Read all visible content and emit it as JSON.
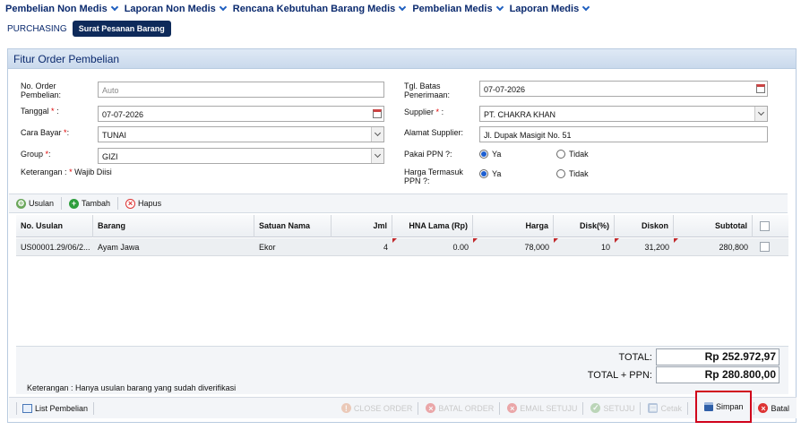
{
  "menu": {
    "items": [
      "Pembelian Non Medis",
      "Laporan Non Medis",
      "Rencana Kebutuhan Barang Medis",
      "Pembelian Medis",
      "Laporan Medis"
    ]
  },
  "subnav": {
    "link": "PURCHASING",
    "active": "Surat Pesanan Barang"
  },
  "panel": {
    "title": "Fitur Order Pembelian"
  },
  "form": {
    "no_order_label": "No. Order Pembelian:",
    "no_order_placeholder": "Auto",
    "tanggal_label": "Tanggal",
    "tanggal_value": "07-07-2026",
    "cara_bayar_label": "Cara Bayar",
    "cara_bayar_value": "TUNAI",
    "group_label": "Group",
    "group_value": "GIZI",
    "keterangan_prefix": "Keterangan :",
    "keterangan_suffix": "Wajib Diisi",
    "req_mark": "*",
    "colon": ":",
    "tgl_batas_label": "Tgl. Batas Penerimaan:",
    "tgl_batas_value": "07-07-2026",
    "supplier_label": "Supplier",
    "supplier_value": "PT. CHAKRA KHAN",
    "alamat_label": "Alamat Supplier:",
    "alamat_value": "Jl. Dupak Masigit No. 51",
    "pakai_ppn_label": "Pakai PPN ?:",
    "harga_ppn_label": "Harga Termasuk PPN ?:",
    "ya": "Ya",
    "tidak": "Tidak"
  },
  "grid_toolbar": {
    "usulan": "Usulan",
    "tambah": "Tambah",
    "hapus": "Hapus"
  },
  "columns": [
    "No. Usulan",
    "Barang",
    "Satuan Nama",
    "Jml",
    "HNA Lama (Rp)",
    "Harga",
    "Disk(%)",
    "Diskon",
    "Subtotal"
  ],
  "rows": [
    {
      "no_usulan": "US00001.29/06/2...",
      "barang": "Ayam Jawa",
      "satuan": "Ekor",
      "jml": "4",
      "hna": "0.00",
      "harga": "78,000",
      "disk": "10",
      "diskon": "31,200",
      "subtotal": "280,800"
    }
  ],
  "summary": {
    "total_label": "TOTAL:",
    "total_value": "Rp 252.972,97",
    "total_ppn_label": "TOTAL + PPN:",
    "total_ppn_value": "Rp 280.800,00",
    "note": "Keterangan : Hanya usulan barang yang sudah diverifikasi"
  },
  "bottom": {
    "list_pembelian": "List Pembelian",
    "close_order": "CLOSE ORDER",
    "batal_order": "BATAL ORDER",
    "email_setuju": "EMAIL SETUJU",
    "setuju": "SETUJU",
    "cetak": "Cetak",
    "simpan": "Simpan",
    "batal": "Batal"
  },
  "colors": {
    "accent": "#0e2a5a",
    "highlight_border": "#d0021b"
  }
}
